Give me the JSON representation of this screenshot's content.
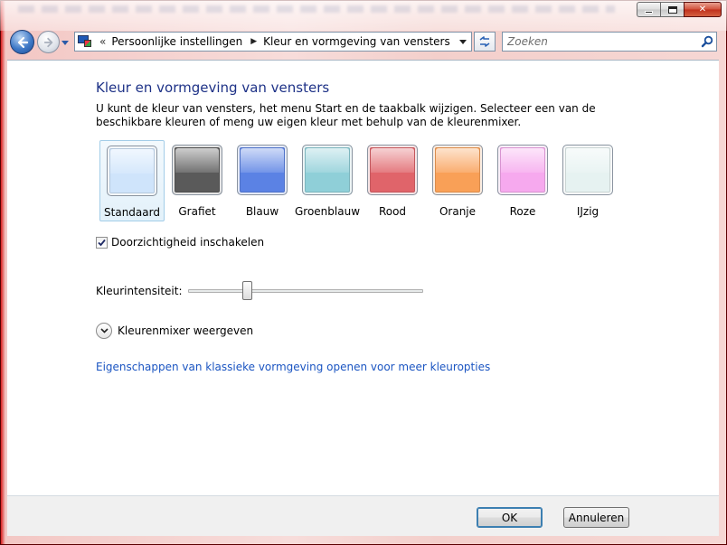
{
  "window": {
    "caption_buttons": {
      "minimize": "minimize-icon",
      "maximize": "maximize-icon",
      "close": "✕"
    }
  },
  "nav": {
    "back_icon": "back-arrow-icon",
    "forward_icon": "forward-arrow-icon",
    "overflow_glyph": "«",
    "breadcrumbs": [
      "Persoonlijke instellingen",
      "Kleur en vormgeving van vensters"
    ],
    "search_placeholder": "Zoeken"
  },
  "main": {
    "title": "Kleur en vormgeving van vensters",
    "description": "U kunt de kleur van vensters, het menu Start en de taakbalk wijzigen. Selecteer een van de beschikbare kleuren of meng uw eigen kleur met behulp van de kleurenmixer.",
    "swatches": [
      {
        "label": "Standaard",
        "color": "#cfe4fb",
        "selected": true
      },
      {
        "label": "Grafiet",
        "color": "#5a5a5a",
        "selected": false
      },
      {
        "label": "Blauw",
        "color": "#5b82e4",
        "selected": false
      },
      {
        "label": "Groenblauw",
        "color": "#8fcfd8",
        "selected": false
      },
      {
        "label": "Rood",
        "color": "#e0646a",
        "selected": false
      },
      {
        "label": "Oranje",
        "color": "#f9a057",
        "selected": false
      },
      {
        "label": "Roze",
        "color": "#f6a9ee",
        "selected": false
      },
      {
        "label": "IJzig",
        "color": "#e6f2f1",
        "selected": false
      }
    ],
    "transparency": {
      "label": "Doorzichtigheid inschakelen",
      "checked": true
    },
    "intensity": {
      "label": "Kleurintensiteit:",
      "value_fraction": 0.24
    },
    "mixer": {
      "label": "Kleurenmixer weergeven"
    },
    "classic_link": "Eigenschappen van klassieke vormgeving openen voor meer kleuropties"
  },
  "footer": {
    "ok_label": "OK",
    "cancel_label": "Annuleren"
  },
  "colors": {
    "accent_title": "#1e3287",
    "link": "#1b55c2",
    "frame": "#d92020"
  }
}
